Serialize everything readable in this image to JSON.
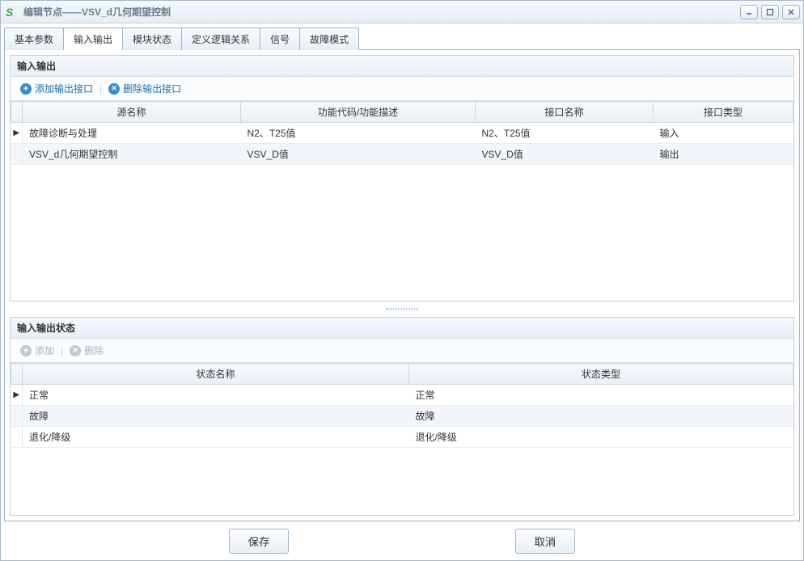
{
  "window": {
    "title": "编辑节点——VSV_d几何期望控制"
  },
  "tabs": [
    "基本参数",
    "输入输出",
    "模块状态",
    "定义逻辑关系",
    "信号",
    "故障模式"
  ],
  "active_tab_index": 1,
  "io_panel": {
    "title": "输入输出",
    "toolbar": {
      "add": "添加输出接口",
      "del": "删除输出接口"
    },
    "columns": [
      "源名称",
      "功能代码/功能描述",
      "接口名称",
      "接口类型"
    ],
    "rows": [
      {
        "src": "故障诊断与处理",
        "func": "N2、T25值",
        "iface": "N2、T25值",
        "type": "输入"
      },
      {
        "src": "VSV_d几何期望控制",
        "func": "VSV_D值",
        "iface": "VSV_D值",
        "type": "输出"
      }
    ]
  },
  "state_panel": {
    "title": "输入输出状态",
    "toolbar": {
      "add": "添加",
      "del": "删除"
    },
    "columns": [
      "状态名称",
      "状态类型"
    ],
    "rows": [
      {
        "name": "正常",
        "type": "正常"
      },
      {
        "name": "故障",
        "type": "故障"
      },
      {
        "name": "退化/降级",
        "type": "退化/降级"
      }
    ]
  },
  "buttons": {
    "save": "保存",
    "cancel": "取消"
  }
}
